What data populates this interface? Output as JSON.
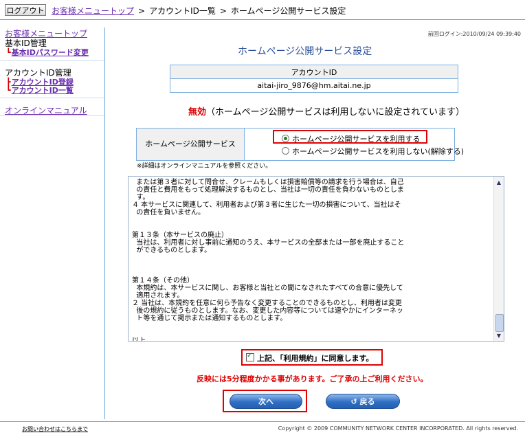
{
  "header": {
    "logout_label": "ログアウト",
    "breadcrumb": [
      "お客様メニュートップ",
      "アカウントID一覧",
      "ホームページ公開サービス設定"
    ],
    "separator": ">"
  },
  "sidebar": {
    "menu_top": "お客様メニュートップ",
    "basic_id_heading": "基本ID管理",
    "basic_pw_change": "基本IDパスワード変更",
    "account_heading": "アカウントID管理",
    "account_register": "アカウントID登録",
    "account_list": "アカウントID一覧",
    "online_manual": "オンラインマニュアル"
  },
  "main": {
    "last_login": "前回ログイン:2010/09/24 09:39:40",
    "title": "ホームページ公開サービス設定",
    "account_header": "アカウントID",
    "account_value": "aitai-jiro_9876@hm.aitai.ne.jp",
    "status_word": "無効",
    "status_detail": "（ホームページ公開サービスは利用しないに設定されています）",
    "service_label": "ホームページ公開サービス",
    "option_use": "ホームページ公開サービスを利用する",
    "option_not_use": "ホームページ公開サービスを利用しない(解除する)",
    "selected_option": "option_use",
    "note": "※詳細はオンラインマニュアルを参照ください。",
    "terms_text": "  または第３者に対して問合せ、クレームもしくは損害賠償等の請求を行う場合は、自己\n  の責任と費用をもって処理解決するものとし、当社は一切の責任を負わないものとしま\n  す。\n４ 本サービスに関連して、利用者および第３者に生じた一切の損害について、当社はそ\n  の責任を負いません。\n\n\n第１３条（本サービスの廃止）\n  当社は、利用者に対し事前に通知のうえ、本サービスの全部または一部を廃止すること\n  ができるものとします。\n\n\n\n第１４条（その他）\n  本規約は、本サービスに関し、お客様と当社との間になされたすべての合意に優先して\n  適用されます。\n２ 当社は、本規約を任意に何ら予告なく変更することのできるものとし、利用者は変更\n  後の規約に従うものとします。なお、変更した内容等については速やかにインターネッ\n  ト等を通じて掲示または通知するものとします。\n\n\n以上",
    "agree_label": "上記、「利用規約」に同意します。",
    "agree_checked": true,
    "warning": "反映には5分程度かかる事があります。ご了承の上ご利用ください。",
    "next_label": "次へ",
    "back_label": "戻る"
  },
  "footer": {
    "contact": "お問い合わせはこちらまで",
    "copyright": "Copyright © 2009 COMMUNITY NETWORK CENTER INCORPORATED. All rights reserved."
  },
  "colors": {
    "accent_blue": "#2a4f9a",
    "alert_red": "#e00000",
    "link_purple": "#6a2fb0",
    "border_blue": "#7aaee0"
  }
}
